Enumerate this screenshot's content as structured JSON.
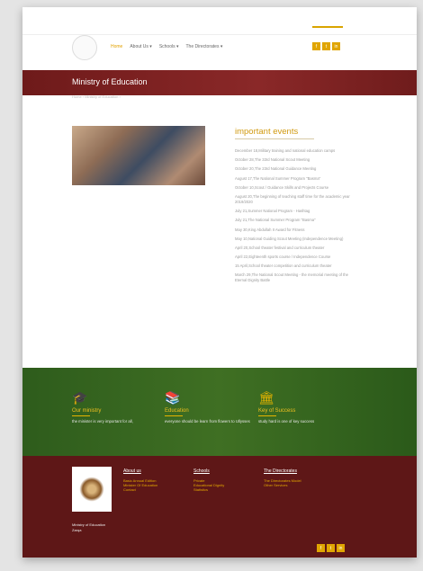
{
  "header": {
    "nav": [
      {
        "label": "Home",
        "active": true
      },
      {
        "label": "About Us ▾",
        "active": false
      },
      {
        "label": "Schools ▾",
        "active": false
      },
      {
        "label": "The Directorates ▾",
        "active": false
      }
    ],
    "social": [
      "f",
      "t",
      "in"
    ]
  },
  "banner": {
    "title": "Ministry of Education"
  },
  "breadcrumb": "Home  ›  Ministry of Education  ›",
  "events": {
    "title": "important events",
    "items": [
      "December 18,Military training and national education camps",
      "October 28,The 33rd National Scout Meeting",
      "October 20,The 23rd National Guidance Meeting",
      "August 17,The National Summer Program \"Basma\"",
      "October 10,Scout / Guidance Skills and Projects Course",
      "August 20,The beginning of teaching staff time for the academic year 2019/2020",
      "July 21,Summer National Program - Hashtag",
      "July 21,The National Summer Program \"Basma\"",
      "May 30,King Abdullah II Award for Fitness",
      "May 10,National Guiding Scout Meeting (Independence Meeting)",
      "April 20,School theater festival and curriculum theater",
      "April 22,Eighteenth sports course / Independence Course",
      "15 April,School theater competition and curriculum theater",
      "March 29,The National Scout Meeting - the memorial meeting of the Eternal Dignity Battle"
    ]
  },
  "features": [
    {
      "icon": "graduation-cap-icon",
      "title": "Our ministry",
      "text": "the minister is very important for all,"
    },
    {
      "icon": "books-icon",
      "title": "Education",
      "text": "everyone should be learn from flowers to Ullysses"
    },
    {
      "icon": "school-building-icon",
      "title": "Key of Success",
      "text": "study hard is one of key success"
    }
  ],
  "footer": {
    "org_name": "Ministry of Education",
    "org_sub": "Zarqa",
    "columns": [
      {
        "title": "About us",
        "links": [
          "Basic Annual Edition",
          "Minister Of Education",
          "Contact"
        ]
      },
      {
        "title": "Schools",
        "links": [
          "Private",
          "Educational Dignity",
          "Statistics"
        ]
      },
      {
        "title": "The Directorates",
        "links": [
          "The Directorates Model",
          "Other Services"
        ]
      }
    ],
    "social": [
      "f",
      "t",
      "in"
    ]
  },
  "colors": {
    "accent": "#e0a500",
    "banner": "#7a2020",
    "features_bg": "#3a6a22",
    "footer_bg": "#5e1717"
  }
}
